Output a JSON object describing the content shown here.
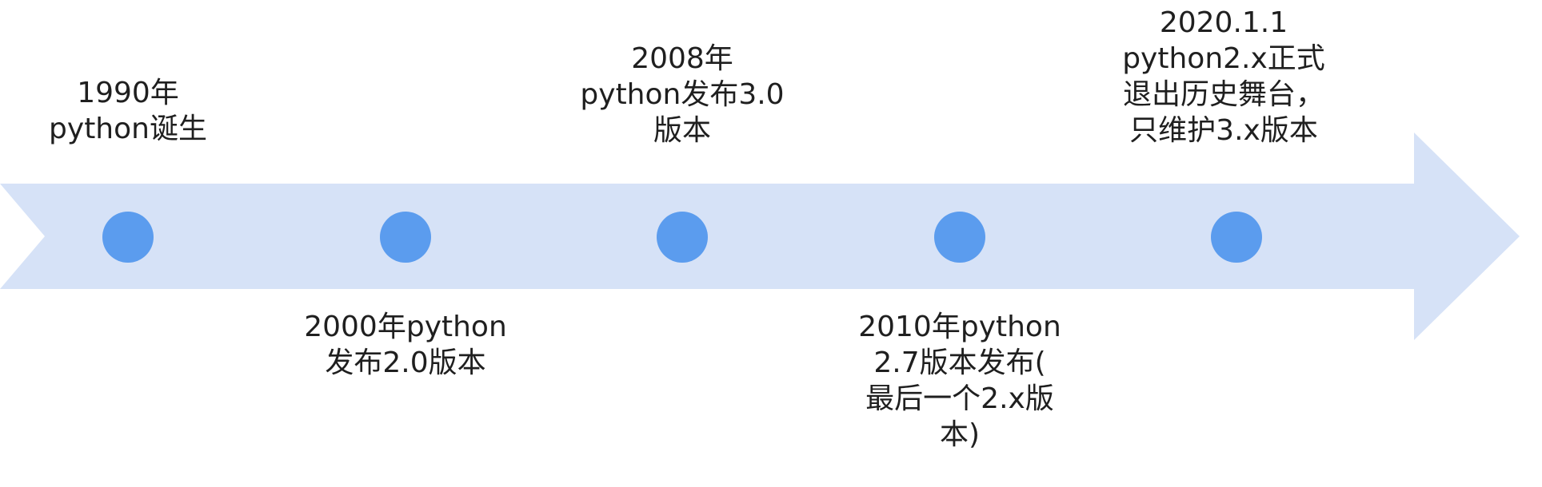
{
  "theme": {
    "arrow_color": "#d6e2f7",
    "dot_color": "#5b9cee",
    "text_color": "#1f1f1f"
  },
  "events": [
    {
      "lines": [
        "1990年",
        "python诞生"
      ],
      "position": "above"
    },
    {
      "lines": [
        "2000年python",
        "发布2.0版本"
      ],
      "position": "below"
    },
    {
      "lines": [
        "2008年",
        "python发布3.0",
        "版本"
      ],
      "position": "above"
    },
    {
      "lines": [
        "2010年python",
        "2.7版本发布(",
        "最后一个2.x版",
        "本)"
      ],
      "position": "below"
    },
    {
      "lines": [
        "2020.1.1",
        "python2.x正式",
        "退出历史舞台，",
        "只维护3.x版本"
      ],
      "position": "above"
    }
  ]
}
